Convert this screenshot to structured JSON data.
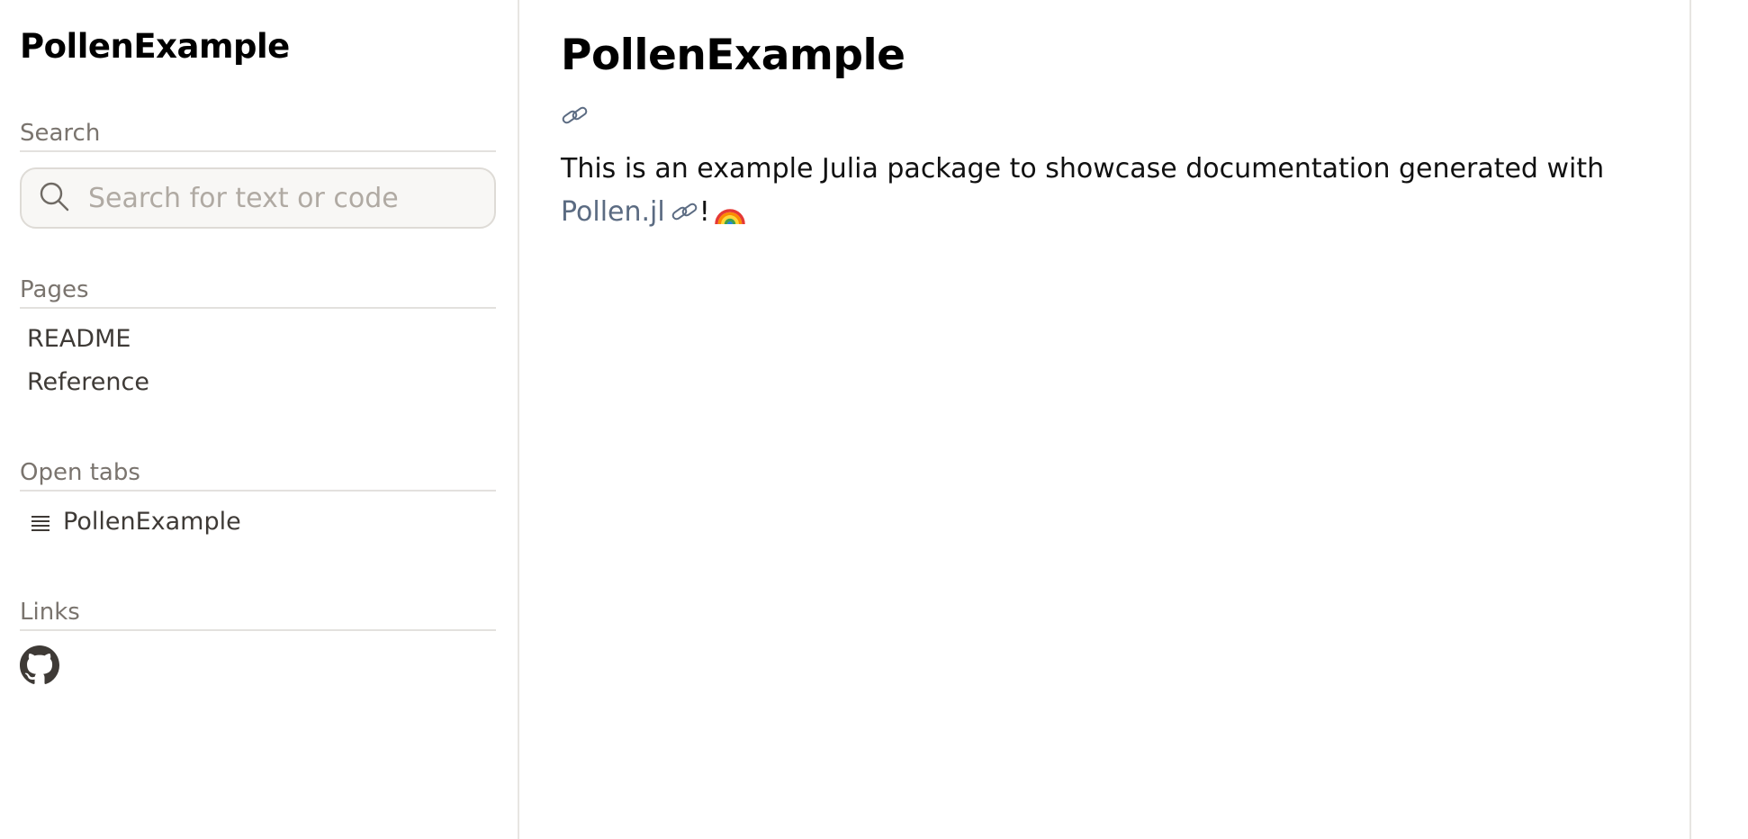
{
  "sidebar": {
    "site_title": "PollenExample",
    "search": {
      "label": "Search",
      "placeholder": "Search for text or code",
      "icon": "search-icon"
    },
    "pages": {
      "label": "Pages",
      "items": [
        {
          "label": "README"
        },
        {
          "label": "Reference"
        }
      ]
    },
    "open_tabs": {
      "label": "Open tabs",
      "items": [
        {
          "label": "PollenExample",
          "icon": "list-icon"
        }
      ]
    },
    "links": {
      "label": "Links",
      "items": [
        {
          "icon": "github-icon"
        }
      ]
    }
  },
  "main": {
    "title": "PollenExample",
    "paragraph_text": "This is an example Julia package to showcase documentation generated with",
    "link_text": "Pollen.jl",
    "after_link": "!",
    "link_color": "#5b6b82"
  }
}
